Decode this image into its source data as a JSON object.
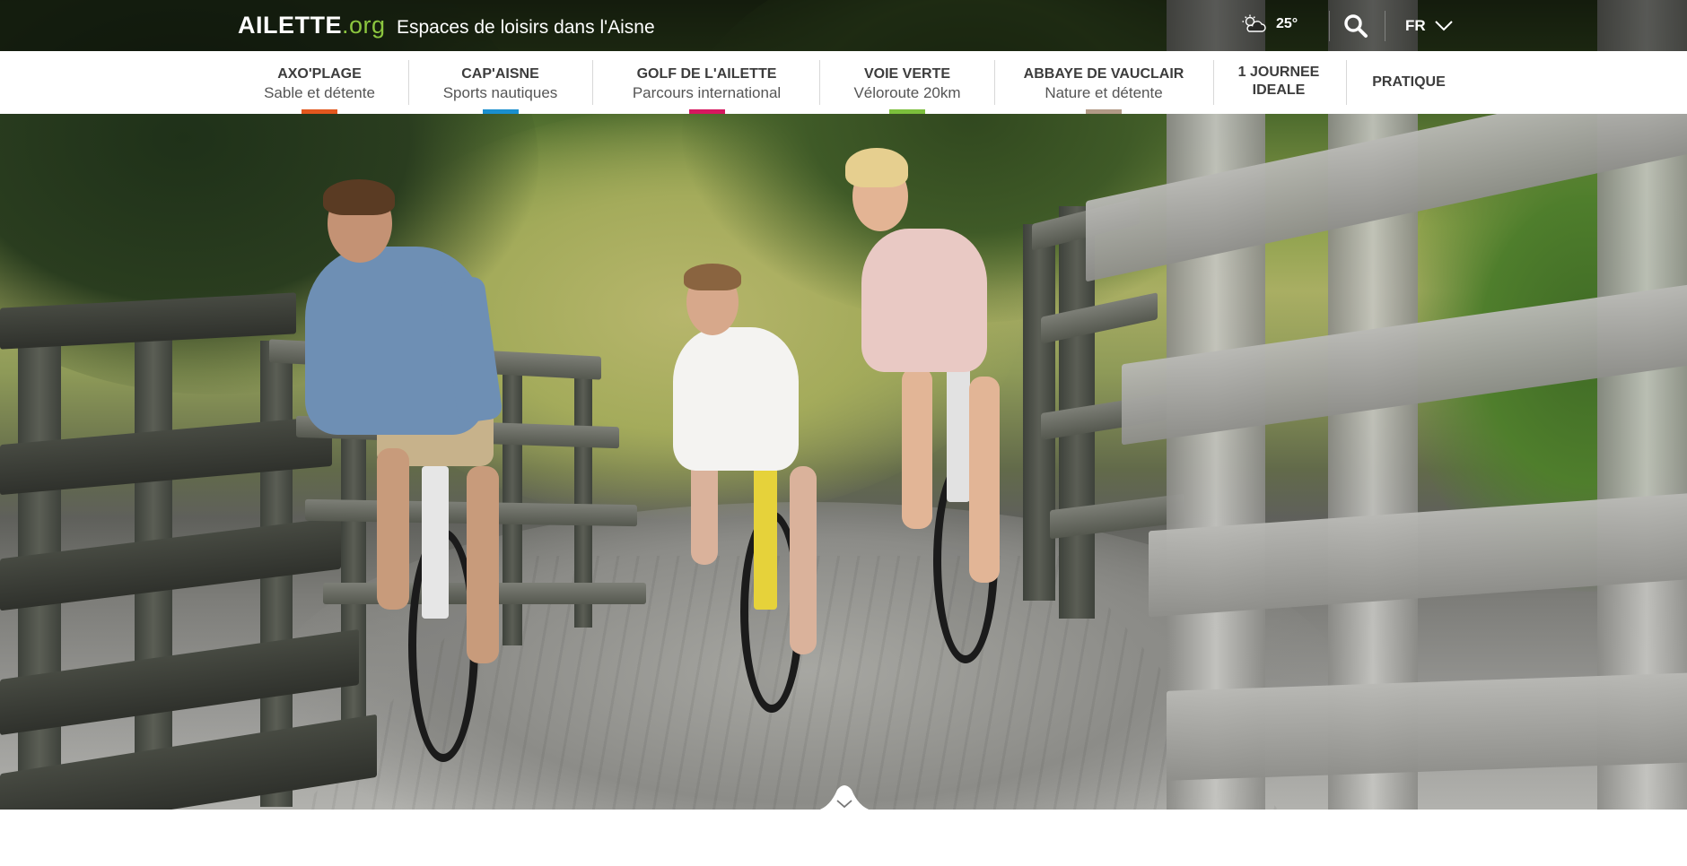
{
  "brand": {
    "logo_main": "AILETTE",
    "logo_suffix": ".org",
    "tagline": "Espaces de loisirs dans l'Aisne",
    "accent_color": "#8cc63f"
  },
  "header": {
    "weather_icon": "partly-cloudy-icon",
    "temperature": "25°",
    "search_icon": "search-icon",
    "language": "FR",
    "language_icon": "chevron-down-icon"
  },
  "nav": {
    "items": [
      {
        "title": "AXO'PLAGE",
        "subtitle": "Sable et détente",
        "color": "#e2571e"
      },
      {
        "title": "CAP'AISNE",
        "subtitle": "Sports nautiques",
        "color": "#1a8fce"
      },
      {
        "title": "GOLF DE L'AILETTE",
        "subtitle": "Parcours international",
        "color": "#d6175f"
      },
      {
        "title": "VOIE VERTE",
        "subtitle": "Véloroute 20km",
        "color": "#7cbf3c"
      },
      {
        "title": "ABBAYE DE VAUCLAIR",
        "subtitle": "Nature et détente",
        "color": "#b29a86"
      },
      {
        "title_line1": "1 JOURNEE",
        "title_line2": "IDEALE"
      },
      {
        "title": "PRATIQUE"
      }
    ]
  },
  "hero": {
    "scroll_icon": "chevron-down-icon"
  }
}
